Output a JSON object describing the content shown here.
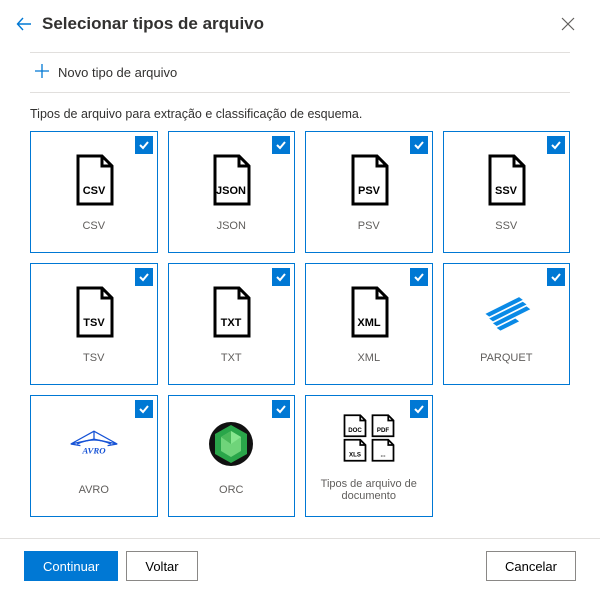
{
  "header": {
    "title": "Selecionar tipos de arquivo"
  },
  "new_type": {
    "label": "Novo tipo de arquivo"
  },
  "description": "Tipos de arquivo para extração e classificação de esquema.",
  "cards": {
    "csv": {
      "label": "CSV",
      "ext": "CSV",
      "checked": true
    },
    "json": {
      "label": "JSON",
      "ext": "JSON",
      "checked": true
    },
    "psv": {
      "label": "PSV",
      "ext": "PSV",
      "checked": true
    },
    "ssv": {
      "label": "SSV",
      "ext": "SSV",
      "checked": true
    },
    "tsv": {
      "label": "TSV",
      "ext": "TSV",
      "checked": true
    },
    "txt": {
      "label": "TXT",
      "ext": "TXT",
      "checked": true
    },
    "xml": {
      "label": "XML",
      "ext": "XML",
      "checked": true
    },
    "parquet": {
      "label": "PARQUET",
      "checked": true
    },
    "avro": {
      "label": "AVRO",
      "checked": true
    },
    "orc": {
      "label": "ORC",
      "checked": true
    },
    "docs": {
      "label": "Tipos de arquivo de documento",
      "checked": true
    }
  },
  "footer": {
    "continue": "Continuar",
    "back": "Voltar",
    "cancel": "Cancelar"
  }
}
